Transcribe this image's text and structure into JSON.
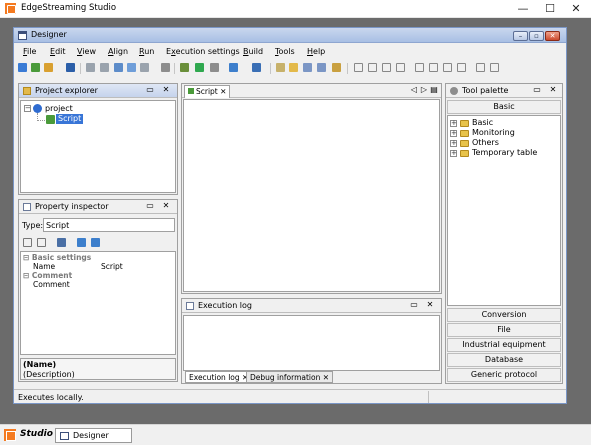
{
  "app": {
    "title": "EdgeStreaming Studio"
  },
  "window_controls": {
    "minimize": "—",
    "maximize": "☐",
    "close": "✕"
  },
  "designer": {
    "title": "Designer",
    "menu": [
      {
        "label": "File",
        "key": "F"
      },
      {
        "label": "Edit",
        "key": "E"
      },
      {
        "label": "View",
        "key": "V"
      },
      {
        "label": "Align",
        "key": "A"
      },
      {
        "label": "Run",
        "key": "R"
      },
      {
        "label": "Execution settings",
        "key": "x"
      },
      {
        "label": "Build",
        "key": "B"
      },
      {
        "label": "Tools",
        "key": "T"
      },
      {
        "label": "Help",
        "key": "H"
      }
    ]
  },
  "project_explorer": {
    "title": "Project explorer",
    "root": "project",
    "child": "Script"
  },
  "property_inspector": {
    "title": "Property inspector",
    "type_label": "Type:",
    "type_value": "Script",
    "sections": [
      {
        "name": "Basic settings",
        "rows": [
          {
            "key": "Name",
            "value": "Script"
          }
        ]
      },
      {
        "name": "Comment",
        "rows": [
          {
            "key": "Comment",
            "value": ""
          }
        ]
      }
    ],
    "desc_name": "(Name)",
    "desc_text": "(Description)"
  },
  "editor": {
    "tab": "Script"
  },
  "execution_log": {
    "title": "Execution log",
    "tabs": [
      "Execution log",
      "Debug information"
    ]
  },
  "tool_palette": {
    "title": "Tool palette",
    "header": "Basic",
    "tree": [
      "Basic",
      "Monitoring",
      "Others",
      "Temporary table"
    ],
    "sections": [
      "Conversion",
      "File",
      "Industrial equipment",
      "Database",
      "Generic protocol"
    ]
  },
  "status": {
    "text": "Executes locally."
  },
  "taskbar": {
    "start_label": "Studio",
    "item": "Designer"
  },
  "colors": {
    "accent": "#f47a20",
    "titlebar": "#a8bfe4",
    "desktop": "#6b6b6b",
    "selection": "#3875d7"
  }
}
